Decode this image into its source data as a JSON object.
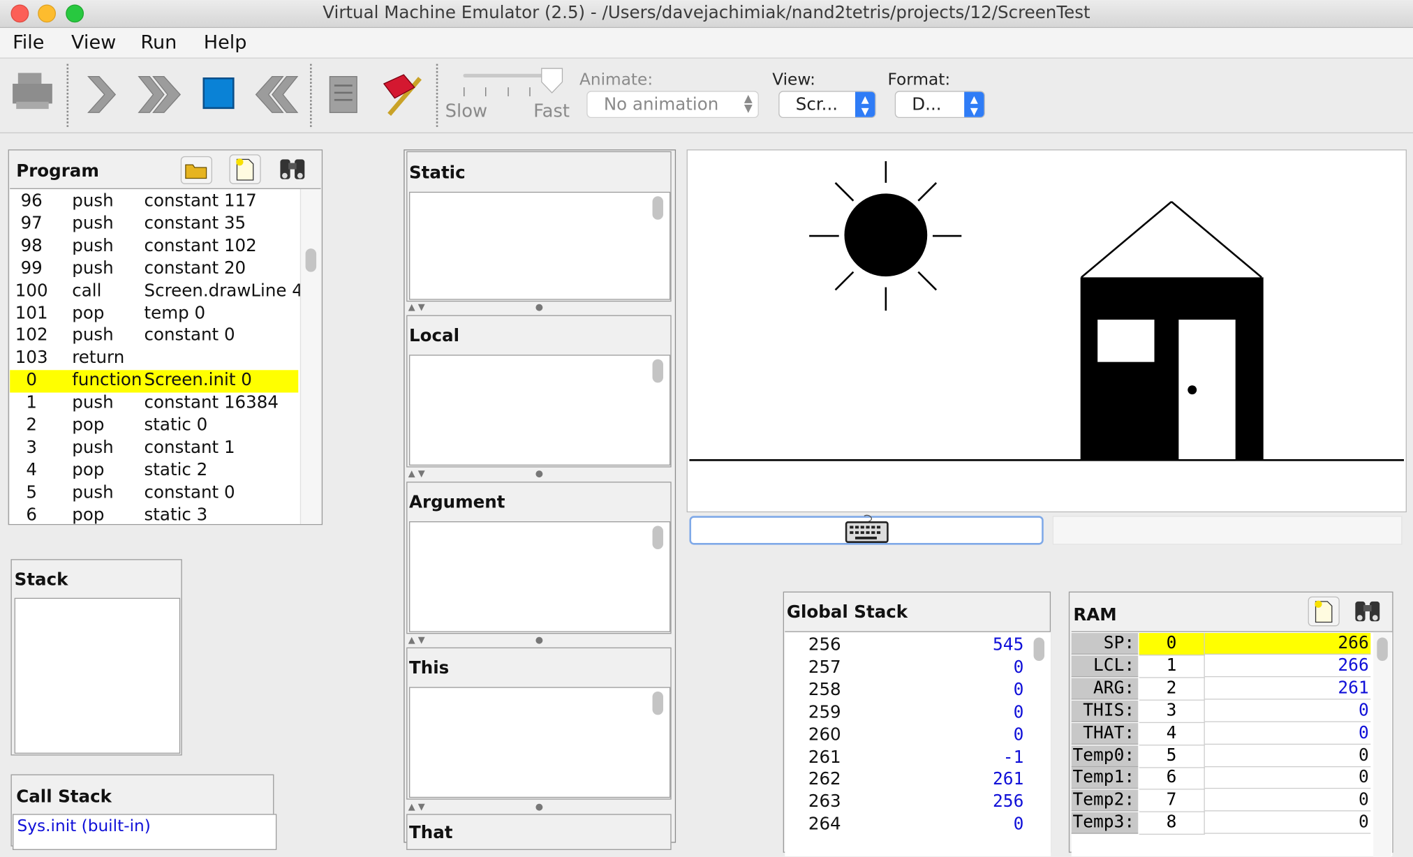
{
  "window": {
    "title": "Virtual Machine Emulator (2.5) - /Users/davejachimiak/nand2tetris/projects/12/ScreenTest"
  },
  "menu": [
    "File",
    "View",
    "Run",
    "Help"
  ],
  "toolbar": {
    "speed_slow": "Slow",
    "speed_fast": "Fast",
    "animate_label": "Animate:",
    "animate_value": "No animation",
    "view_label": "View:",
    "view_value": "Scr...",
    "format_label": "Format:",
    "format_value": "D..."
  },
  "program": {
    "title": "Program",
    "rows": [
      {
        "n": "96",
        "op": "push",
        "arg": "constant 117"
      },
      {
        "n": "97",
        "op": "push",
        "arg": "constant 35"
      },
      {
        "n": "98",
        "op": "push",
        "arg": "constant 102"
      },
      {
        "n": "99",
        "op": "push",
        "arg": "constant 20"
      },
      {
        "n": "100",
        "op": "call",
        "arg": "Screen.drawLine 4"
      },
      {
        "n": "101",
        "op": "pop",
        "arg": "temp 0"
      },
      {
        "n": "102",
        "op": "push",
        "arg": "constant 0"
      },
      {
        "n": "103",
        "op": "return",
        "arg": ""
      },
      {
        "n": "0",
        "op": "function",
        "arg": "Screen.init 0"
      },
      {
        "n": "1",
        "op": "push",
        "arg": "constant 16384"
      },
      {
        "n": "2",
        "op": "pop",
        "arg": "static 0"
      },
      {
        "n": "3",
        "op": "push",
        "arg": "constant 1"
      },
      {
        "n": "4",
        "op": "pop",
        "arg": "static 2"
      },
      {
        "n": "5",
        "op": "push",
        "arg": "constant 0"
      },
      {
        "n": "6",
        "op": "pop",
        "arg": "static 3"
      }
    ],
    "highlight_index": 8
  },
  "stack": {
    "title": "Stack"
  },
  "call_stack": {
    "title": "Call Stack",
    "items": [
      "Sys.init (built-in)"
    ]
  },
  "segments": {
    "static": "Static",
    "local": "Local",
    "argument": "Argument",
    "this": "This",
    "that": "That"
  },
  "global_stack": {
    "title": "Global Stack",
    "rows": [
      {
        "addr": "256",
        "val": "545"
      },
      {
        "addr": "257",
        "val": "0"
      },
      {
        "addr": "258",
        "val": "0"
      },
      {
        "addr": "259",
        "val": "0"
      },
      {
        "addr": "260",
        "val": "0"
      },
      {
        "addr": "261",
        "val": "-1"
      },
      {
        "addr": "262",
        "val": "261"
      },
      {
        "addr": "263",
        "val": "256"
      },
      {
        "addr": "264",
        "val": "0"
      }
    ]
  },
  "ram": {
    "title": "RAM",
    "rows": [
      {
        "label": "SP:",
        "addr": "0",
        "val": "266",
        "blue": false,
        "hl": true
      },
      {
        "label": "LCL:",
        "addr": "1",
        "val": "266",
        "blue": true,
        "hl": false
      },
      {
        "label": "ARG:",
        "addr": "2",
        "val": "261",
        "blue": true,
        "hl": false
      },
      {
        "label": "THIS:",
        "addr": "3",
        "val": "0",
        "blue": true,
        "hl": false
      },
      {
        "label": "THAT:",
        "addr": "4",
        "val": "0",
        "blue": true,
        "hl": false
      },
      {
        "label": "Temp0:",
        "addr": "5",
        "val": "0",
        "blue": false,
        "hl": false
      },
      {
        "label": "Temp1:",
        "addr": "6",
        "val": "0",
        "blue": false,
        "hl": false
      },
      {
        "label": "Temp2:",
        "addr": "7",
        "val": "0",
        "blue": false,
        "hl": false
      },
      {
        "label": "Temp3:",
        "addr": "8",
        "val": "0",
        "blue": false,
        "hl": false
      }
    ]
  },
  "colors": {
    "highlight": "#ffff00",
    "value_blue": "#1010d8",
    "accent": "#2f7cf6"
  }
}
